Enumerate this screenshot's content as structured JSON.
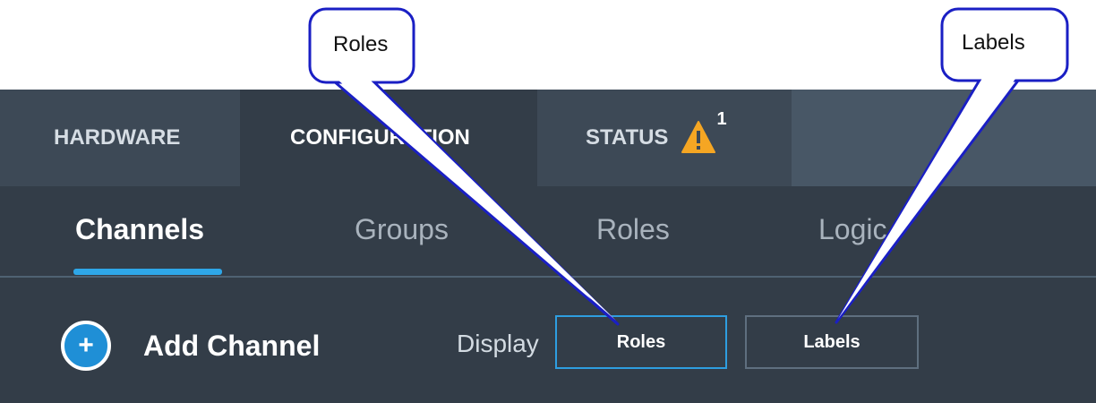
{
  "top_tabs": [
    {
      "label": "HARDWARE"
    },
    {
      "label": "CONFIGURATION"
    },
    {
      "label": "STATUS",
      "badge": "1",
      "icon": "warning-icon"
    }
  ],
  "sub_tabs": [
    {
      "label": "Channels",
      "active": true
    },
    {
      "label": "Groups"
    },
    {
      "label": "Roles"
    },
    {
      "label": "Logic"
    }
  ],
  "toolbar": {
    "add_icon": "plus-circle-icon",
    "add_label": "Add Channel",
    "display_label": "Display",
    "display_options": [
      {
        "label": "Roles",
        "selected": true
      },
      {
        "label": "Labels",
        "selected": false
      }
    ]
  },
  "callouts": [
    {
      "text": "Roles"
    },
    {
      "text": "Labels"
    }
  ],
  "colors": {
    "accent": "#2ea7e8",
    "warning": "#f5a623",
    "background": "#333d48"
  }
}
